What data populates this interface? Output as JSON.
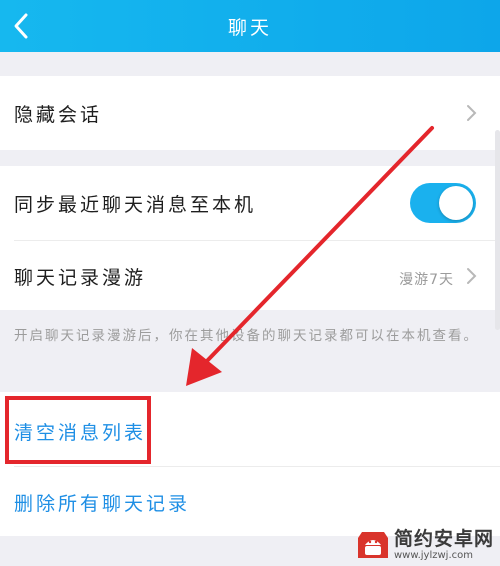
{
  "header": {
    "title": "聊天"
  },
  "rows": {
    "hidden_sessions": "隐藏会话",
    "sync_recent": "同步最近聊天消息至本机",
    "roaming": "聊天记录漫游",
    "roaming_value": "漫游7天"
  },
  "toggle": {
    "sync_recent_on": true
  },
  "hint": "开启聊天记录漫游后，你在其他设备的聊天记录都可以在本机查看。",
  "actions": {
    "clear_list": "清空消息列表",
    "delete_all": "删除所有聊天记录"
  },
  "watermark": {
    "name": "简约安卓网",
    "url": "www.jylzwj.com"
  },
  "colors": {
    "header_bg": "#0da6ea",
    "toggle_on": "#1ab1ee",
    "link_blue": "#1f8fe5",
    "highlight_red": "#e4262c"
  }
}
